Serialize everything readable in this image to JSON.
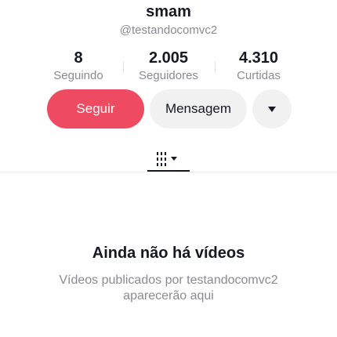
{
  "profile": {
    "name": "smam",
    "handle": "@testandocomvc2"
  },
  "stats": [
    {
      "value": "8",
      "label": "Seguindo"
    },
    {
      "value": "2.005",
      "label": "Seguidores"
    },
    {
      "value": "4.310",
      "label": "Curtidas"
    }
  ],
  "actions": {
    "follow_label": "Seguir",
    "message_label": "Mensagem",
    "more_icon": "caret-down-icon"
  },
  "tabs": {
    "active_icon": "grid-filter-icon"
  },
  "empty_state": {
    "title": "Ainda não há vídeos",
    "description": "Vídeos publicados por testandocomvc2 aparecerão aqui"
  },
  "colors": {
    "accent": "#ee4a61",
    "text": "#161823",
    "muted": "#8a8b91",
    "button_bg": "#f1f1f2"
  }
}
